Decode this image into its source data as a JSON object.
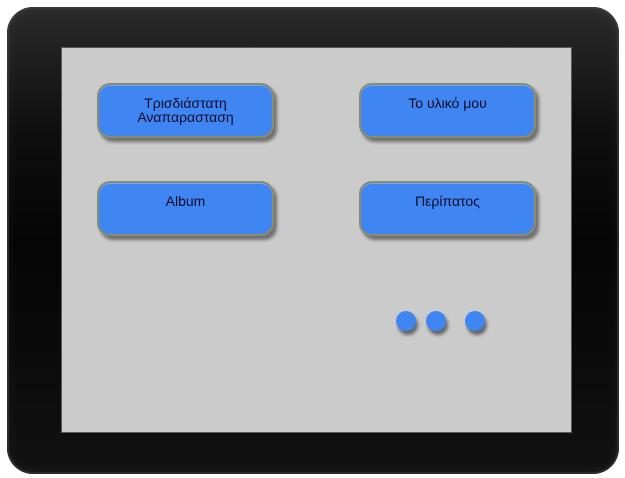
{
  "menu": {
    "buttons": [
      {
        "label": "Τρισδιάστατη\nΑναπαρασταση"
      },
      {
        "label": "Το υλικό μου"
      },
      {
        "label": "Album"
      },
      {
        "label": "Περίπατος"
      }
    ],
    "more_icon": "three-dots-icon"
  },
  "colors": {
    "button_fill": "#3f86f3",
    "button_border": "#8b8b6f",
    "screen_background": "#cbcbcb",
    "device_frame": "#0b0b0b"
  }
}
